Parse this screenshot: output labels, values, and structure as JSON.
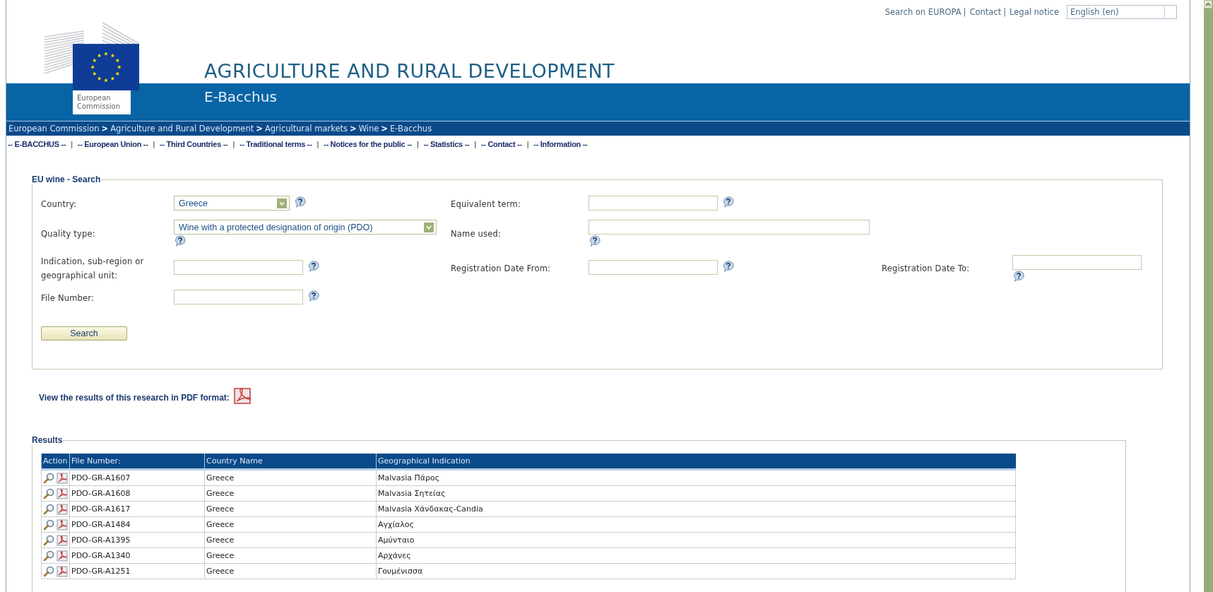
{
  "top_bar": {
    "links": [
      {
        "label": "Search on EUROPA",
        "separator": "|"
      },
      {
        "label": "Contact",
        "separator": "|"
      },
      {
        "label": "Legal notice"
      }
    ],
    "language": "English (en)"
  },
  "logo": {
    "lines": [
      "European",
      "Commission"
    ]
  },
  "header": {
    "title": "AGRICULTURE AND RURAL DEVELOPMENT",
    "subtitle": "E-Bacchus"
  },
  "breadcrumb": [
    {
      "label": "European Commission",
      "separator": ">"
    },
    {
      "label": "Agriculture and Rural Development",
      "separator": ">"
    },
    {
      "label": "Agricultural markets",
      "separator": ">"
    },
    {
      "label": "Wine",
      "separator": ">"
    },
    {
      "label": "E-Bacchus"
    }
  ],
  "nav": [
    {
      "label": "-- E-BACCHUS --",
      "separator": "|"
    },
    {
      "label": "-- European Union --",
      "separator": "|"
    },
    {
      "label": "-- Third Countries --",
      "separator": "|"
    },
    {
      "label": "-- Traditional terms --",
      "separator": "|"
    },
    {
      "label": "-- Notices for the public --",
      "separator": "|"
    },
    {
      "label": "-- Statistics --",
      "separator": "|"
    },
    {
      "label": "-- Contact --",
      "separator": "|"
    },
    {
      "label": "-- Information --"
    }
  ],
  "search_form": {
    "legend": "EU wine - Search",
    "rows": [
      [
        {
          "label": "Country:",
          "kind": "select",
          "value": "Greece",
          "wide": false
        },
        {
          "label": "Equivalent term:",
          "kind": "text",
          "wide": false
        }
      ],
      [
        {
          "label": "Quality type:",
          "kind": "select",
          "value": "Wine with a protected designation of origin (PDO)",
          "wide": true
        },
        {
          "label": "Name used:",
          "kind": "text",
          "wide": true
        }
      ],
      [
        {
          "label": "Indication, sub-region or geographical unit:",
          "kind": "text",
          "wide": false
        },
        {
          "label": "Registration Date From:",
          "kind": "text",
          "wide": false
        },
        {
          "label": "Registration Date To:",
          "kind": "text",
          "wide": false
        }
      ],
      [
        {
          "label": "File Number:",
          "kind": "text",
          "wide": false
        }
      ]
    ],
    "button": "Search"
  },
  "pdf_link": "View the results of this research in PDF format:",
  "results": {
    "legend": "Results",
    "columns": [
      "Action",
      "File Number:",
      "Country Name",
      "Geographical Indication"
    ],
    "rows": [
      {
        "file_number": "PDO-GR-A1607",
        "country": "Greece",
        "indication": "Malvasia Πάρος"
      },
      {
        "file_number": "PDO-GR-A1608",
        "country": "Greece",
        "indication": "Malvasia Σητείας"
      },
      {
        "file_number": "PDO-GR-A1617",
        "country": "Greece",
        "indication": "Malvasia Χάνδακας-Candia"
      },
      {
        "file_number": "PDO-GR-A1484",
        "country": "Greece",
        "indication": "Αγχίαλος"
      },
      {
        "file_number": "PDO-GR-A1395",
        "country": "Greece",
        "indication": "Αμύνταιο"
      },
      {
        "file_number": "PDO-GR-A1340",
        "country": "Greece",
        "indication": "Αρχάνες"
      },
      {
        "file_number": "PDO-GR-A1251",
        "country": "Greece",
        "indication": "Γουμένισσα"
      }
    ]
  }
}
